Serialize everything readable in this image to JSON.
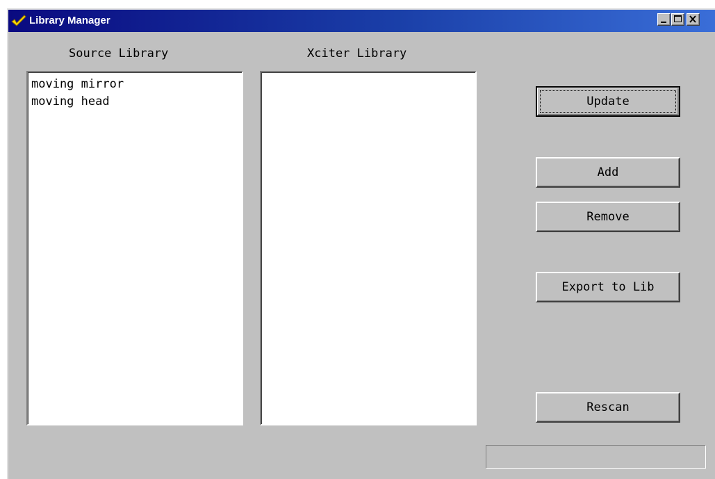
{
  "window": {
    "title": "Library Manager",
    "app_icon": "yellow-check-icon",
    "controls": {
      "minimize_icon": "minimize-icon",
      "maximize_icon": "maximize-icon",
      "close_icon": "close-icon"
    }
  },
  "source_library": {
    "label": "Source Library",
    "items": [
      "moving mirror",
      "moving head"
    ]
  },
  "xciter_library": {
    "label": "Xciter Library",
    "items": []
  },
  "buttons": {
    "update": "Update",
    "add": "Add",
    "remove": "Remove",
    "export": "Export to Lib",
    "rescan": "Rescan"
  },
  "status": {
    "text": ""
  },
  "colors": {
    "face": "#c0c0c0",
    "titlebar_start": "#0a0a80",
    "titlebar_end": "#3a6ed8",
    "list_background": "#ffffff",
    "icon_yellow": "#ffd800"
  }
}
